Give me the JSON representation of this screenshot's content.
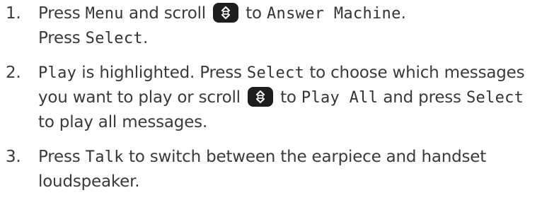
{
  "steps": [
    {
      "number": "1.",
      "line1": {
        "t1": "Press ",
        "k1": "Menu",
        "t2": " and scroll ",
        "t3": " to ",
        "k2": "Answer Machine",
        "t4": "."
      },
      "line2": {
        "t1": "Press ",
        "k1": "Select",
        "t2": "."
      }
    },
    {
      "number": "2.",
      "line1": {
        "k1": "Play",
        "t1": " is highlighted. Press ",
        "k2": "Select",
        "t2": " to choose which messages"
      },
      "line2": {
        "t1": "you want to play or scroll ",
        "t2": " to ",
        "k1": "Play All",
        "t3": " and press ",
        "k2": "Select"
      },
      "line3": {
        "t1": "to play all messages."
      }
    },
    {
      "number": "3.",
      "line1": {
        "t1": "Press ",
        "k1": "Talk",
        "t2": " to switch between the earpiece and handset"
      },
      "line2": {
        "t1": "loudspeaker."
      }
    }
  ],
  "icons": {
    "scroll_key": "up-down-navigation-key-icon"
  },
  "colors": {
    "text": "#3a3a3a",
    "key_background": "#1e1e1e",
    "key_glyph": "#ffffff"
  }
}
